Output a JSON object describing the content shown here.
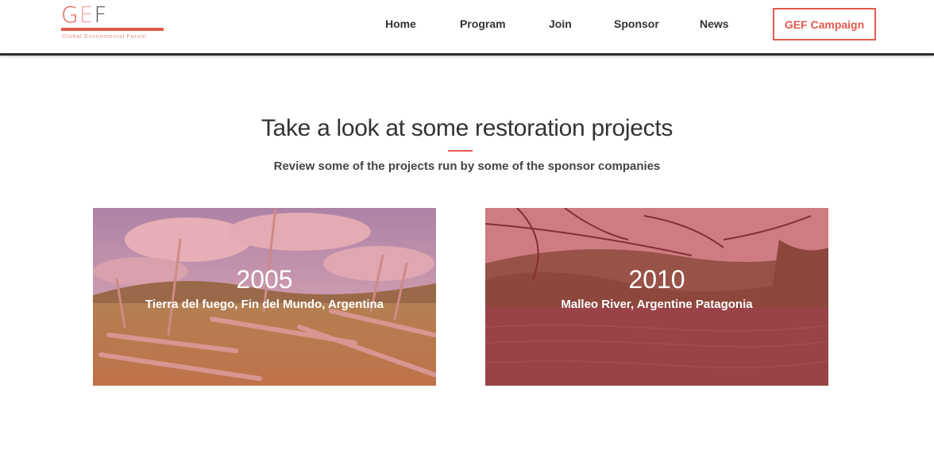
{
  "header": {
    "logo": {
      "letter_g": "G",
      "letter_e": "E",
      "letter_f": "F",
      "subtitle": "Global Enviromental Forum"
    },
    "nav": [
      {
        "label": "Home"
      },
      {
        "label": "Program"
      },
      {
        "label": "Join"
      },
      {
        "label": "Sponsor"
      },
      {
        "label": "News"
      }
    ],
    "cta_label": "GEF Campaign"
  },
  "section": {
    "title": "Take a look at some restoration projects",
    "subtitle": "Review some of the projects run by some of the sponsor companies"
  },
  "projects": [
    {
      "year": "2005",
      "location": "Tierra del fuego, Fin del Mundo, Argentina"
    },
    {
      "year": "2010",
      "location": "Malleo River, Argentine Patagonia"
    }
  ],
  "colors": {
    "accent": "#e25a4d",
    "text": "#333333",
    "header_border": "#2f2f2f"
  }
}
